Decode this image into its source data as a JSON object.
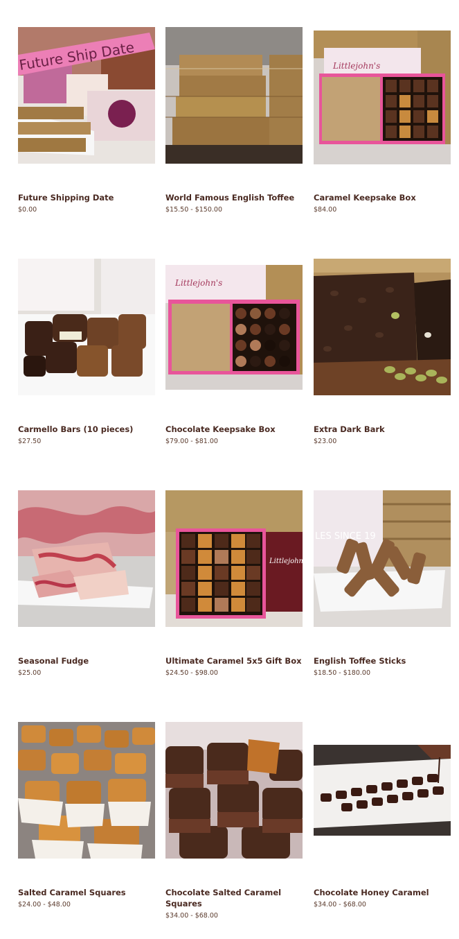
{
  "products": [
    {
      "name": "Future Shipping Date",
      "price": "$0.00",
      "image_caption": "Future Ship Date"
    },
    {
      "name": "World Famous English Toffee",
      "price": "$15.50 - $150.00"
    },
    {
      "name": "Caramel Keepsake Box",
      "price": "$84.00",
      "image_caption": "Littlejohn's"
    },
    {
      "name": "Carmello Bars (10 pieces)",
      "price": "$27.50"
    },
    {
      "name": "Chocolate Keepsake Box",
      "price": "$79.00 - $81.00",
      "image_caption": "Littlejohn's"
    },
    {
      "name": "Extra Dark Bark",
      "price": "$23.00"
    },
    {
      "name": "Seasonal Fudge",
      "price": "$25.00"
    },
    {
      "name": "Ultimate Caramel 5x5 Gift Box",
      "price": "$24.50 - $98.00",
      "image_caption": "Littlejohn's"
    },
    {
      "name": "English Toffee Sticks",
      "price": "$18.50 - $180.00",
      "image_caption": "LES SINCE 19"
    },
    {
      "name": "Salted Caramel Squares",
      "price": "$24.00 - $48.00"
    },
    {
      "name": "Chocolate Salted Caramel Squares",
      "price": "$34.00 - $68.00"
    },
    {
      "name": "Chocolate Honey Caramel",
      "price": "$34.00 - $68.00"
    }
  ]
}
